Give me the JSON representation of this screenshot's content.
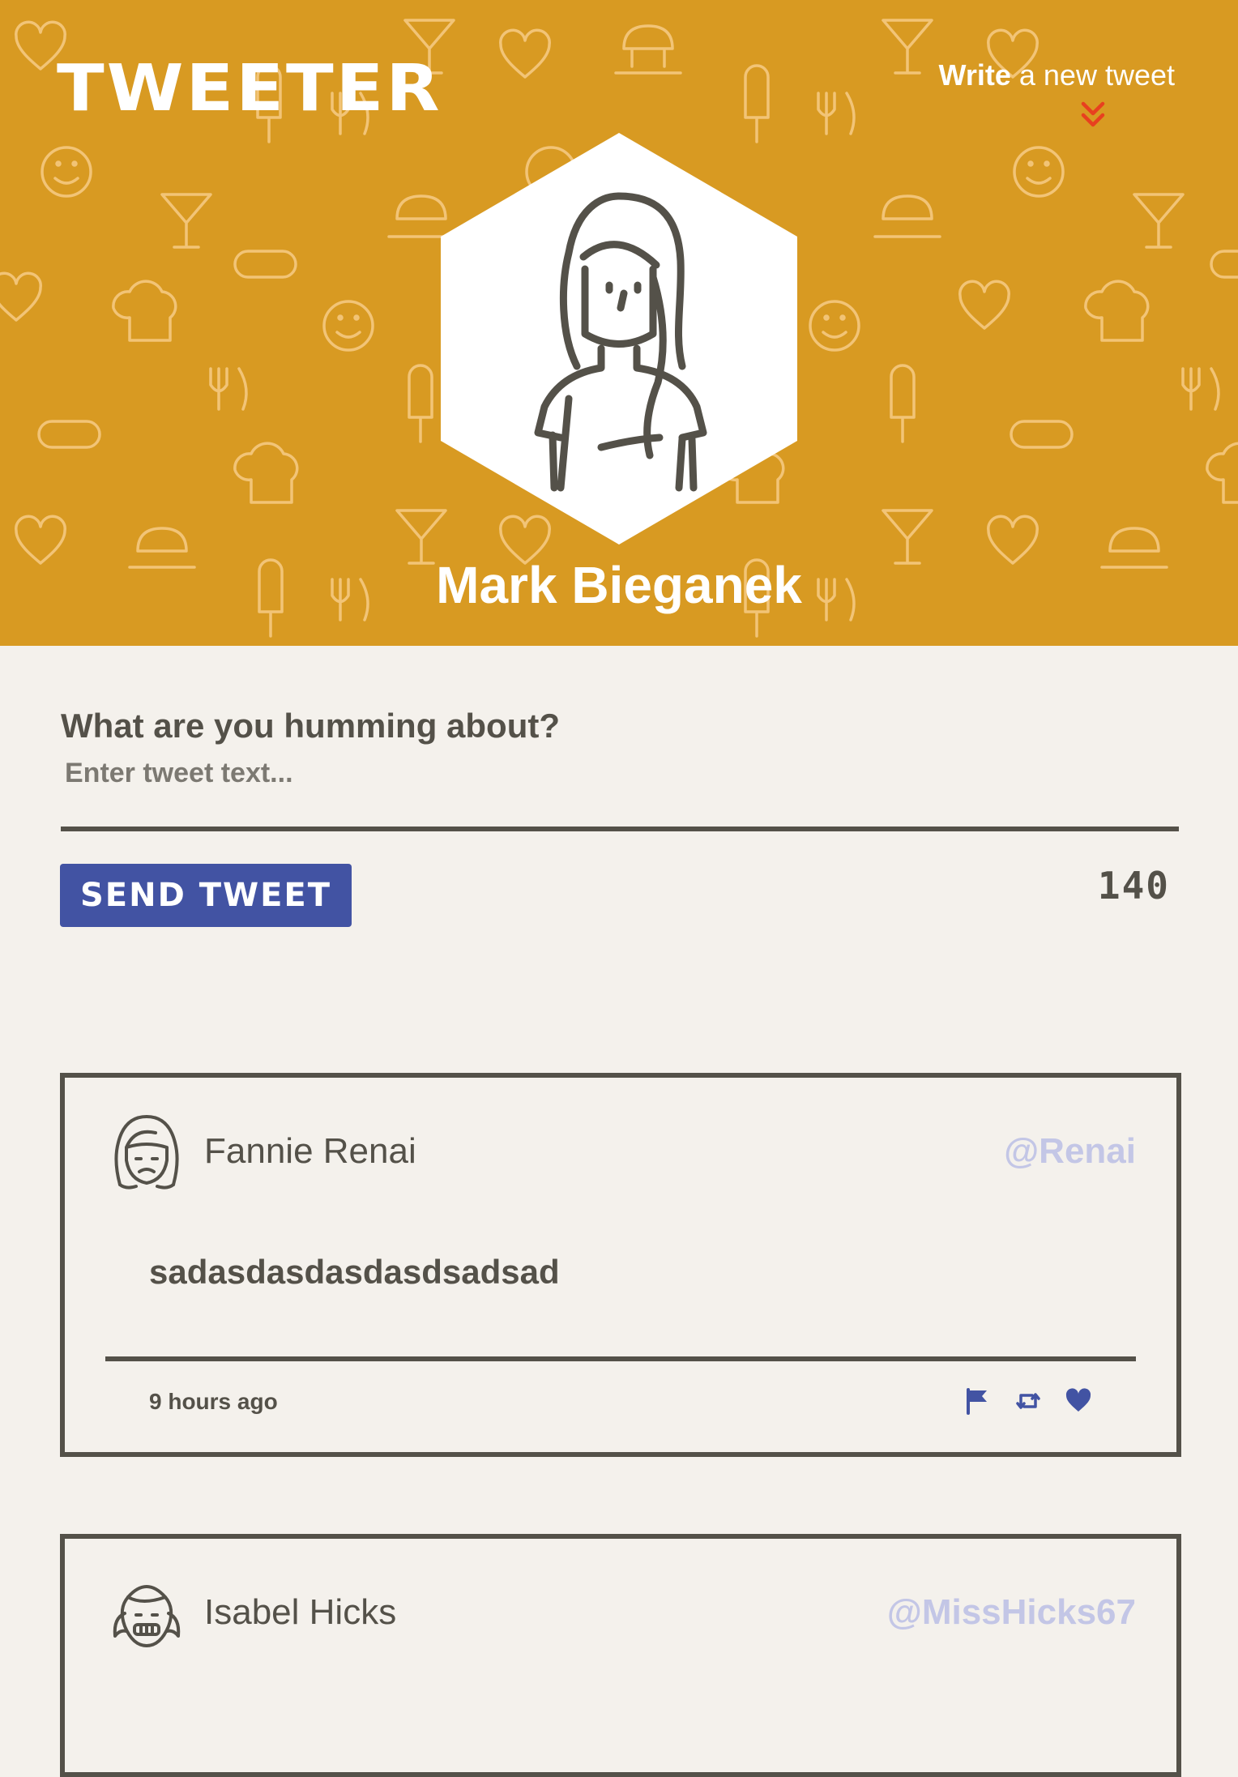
{
  "header": {
    "brand": "TWEETER",
    "compose_toggle_strong": "Write",
    "compose_toggle_light": " a new tweet",
    "profile_name": "Mark Bieganek"
  },
  "compose": {
    "title": "What are you humming about?",
    "placeholder": "Enter tweet text...",
    "send_label": "SEND TWEET",
    "char_count": "140"
  },
  "tweets": [
    {
      "name": "Fannie Renai",
      "handle": "@Renai",
      "body": "sadasdasdasdasdsadsad",
      "time": "9 hours ago"
    },
    {
      "name": "Isabel Hicks",
      "handle": "@MissHicks67"
    }
  ],
  "icons": {
    "toggle": "double-chevron-down-icon",
    "flag": "flag-icon",
    "retweet": "retweet-icon",
    "like": "heart-icon"
  },
  "colors": {
    "header_bg": "#d89a22",
    "accent_blue": "#4253a3",
    "chevron": "#e8401f",
    "handle": "#c3c6e6",
    "text_dark": "#545149",
    "page_bg": "#f4f1ec"
  }
}
